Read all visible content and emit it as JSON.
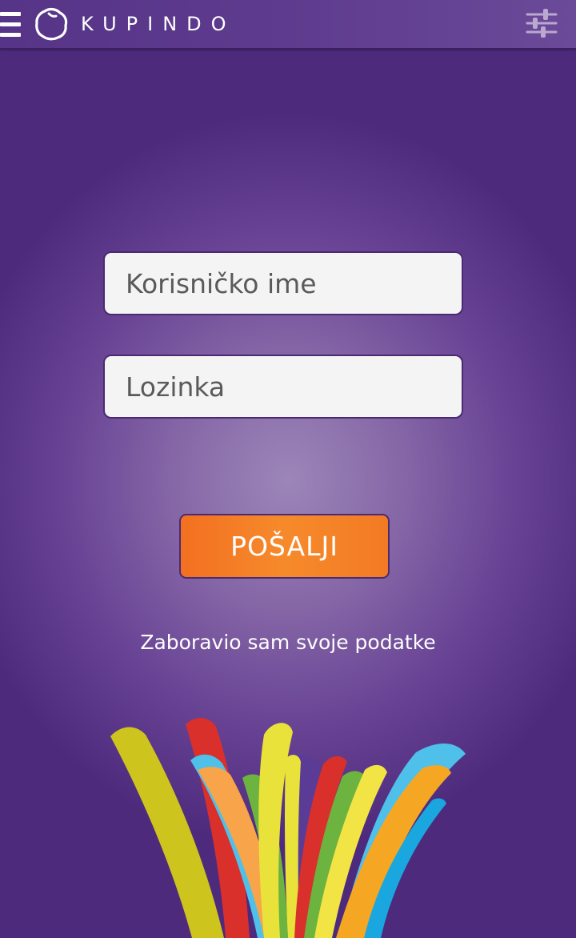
{
  "header": {
    "brand": "KUPINDO",
    "icons": {
      "menu": "menu-icon",
      "logo": "logo-mark-icon",
      "settings": "sliders-icon"
    }
  },
  "login_form": {
    "username_placeholder": "Korisničko ime",
    "password_placeholder": "Lozinka",
    "submit_label": "POŠALJI",
    "forgot_link": "Zaboravio sam svoje podatke"
  },
  "colors": {
    "background": "#4e2a7d",
    "background_center": "#9c86b8",
    "button": "#f37021",
    "input_background": "#f4f4f4",
    "ribbon_colors": [
      "#d6cf1f",
      "#d9302c",
      "#4ec0ea",
      "#f7a44a",
      "#6cb33f",
      "#e8e23a",
      "#5a3c96",
      "#f5a623",
      "#1aa7e0"
    ]
  }
}
